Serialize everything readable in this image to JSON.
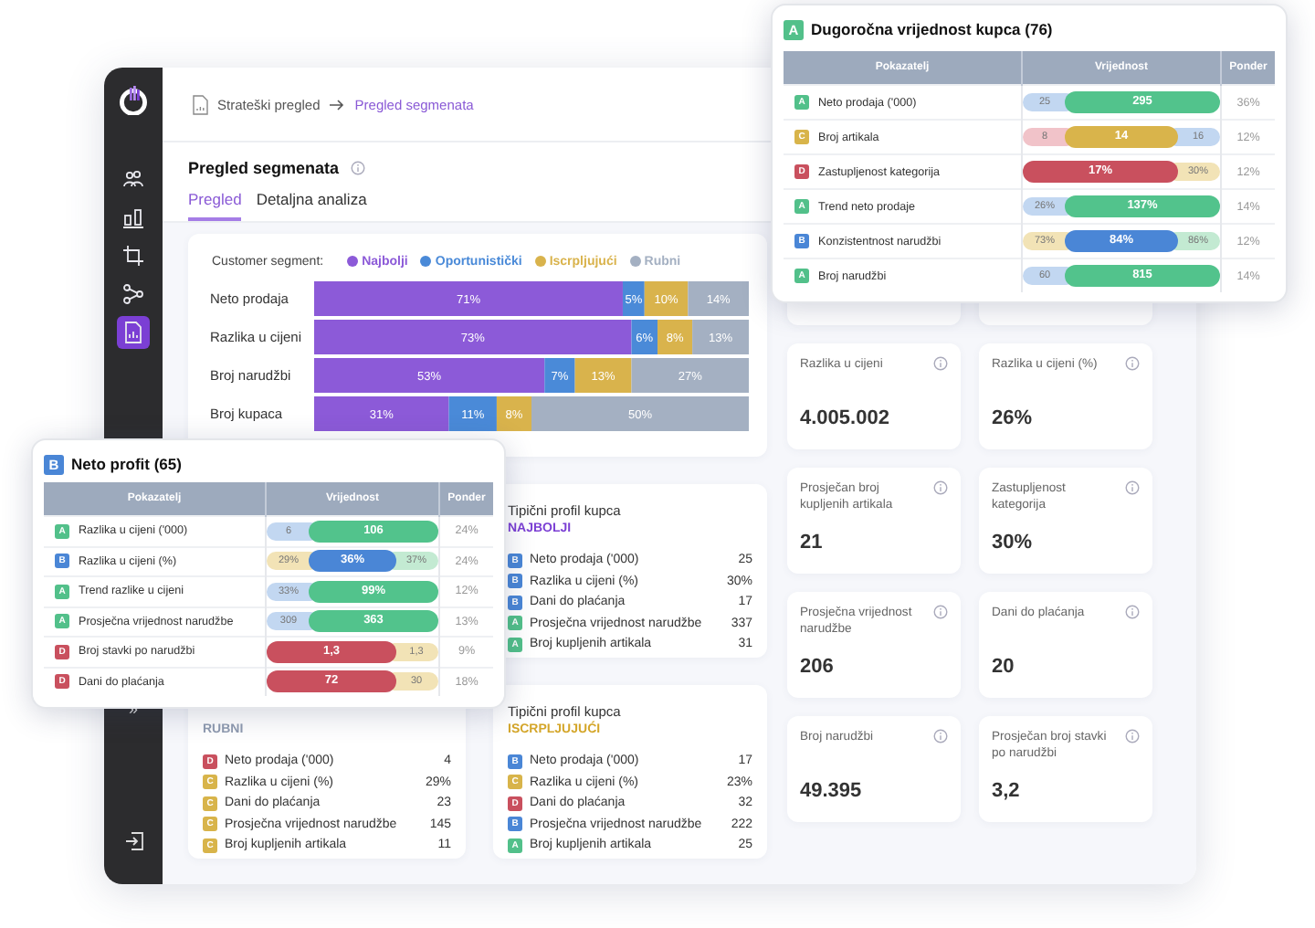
{
  "sidebar": {
    "items": [
      {
        "kind": "people",
        "selected": false
      },
      {
        "kind": "bars",
        "selected": false
      },
      {
        "kind": "crop",
        "selected": false
      },
      {
        "kind": "network",
        "selected": false
      },
      {
        "kind": "report",
        "selected": true
      }
    ],
    "collapse": "»"
  },
  "breadcrumb": [
    "Strateški pregled",
    "Pregled segmenata"
  ],
  "page": {
    "title": "Pregled segmenata",
    "tabs": [
      {
        "label": "Pregled",
        "selected": true
      },
      {
        "label": "Detaljna analiza",
        "selected": false
      }
    ]
  },
  "segment_chart": {
    "legend_label": "Customer segment:",
    "chart_data": {
      "type": "bar",
      "orientation": "horizontal",
      "stacked": true,
      "categories": [
        "Neto prodaja",
        "Razlika u cijeni",
        "Broj narudžbi",
        "Broj kupaca"
      ],
      "series": [
        {
          "name": "Najbolji",
          "color": "#8c5ad8",
          "values": [
            71,
            73,
            53,
            31
          ],
          "value_labels": [
            "71%",
            "73%",
            "53%",
            "31%"
          ]
        },
        {
          "name": "Oportunistički",
          "color": "#4a8ad8",
          "values": [
            5,
            6,
            7,
            11
          ],
          "value_labels": [
            "5%",
            "6%",
            "7%",
            "11%"
          ]
        },
        {
          "name": "Iscrpljujući",
          "color": "#d9b34c",
          "values": [
            10,
            8,
            13,
            8
          ],
          "value_labels": [
            "10%",
            "8%",
            "13%",
            "8%"
          ]
        },
        {
          "name": "Rubni",
          "color": "#a4b0c2",
          "values": [
            14,
            13,
            27,
            50
          ],
          "value_labels": [
            "14%",
            "13%",
            "27%",
            "50%"
          ]
        }
      ]
    }
  },
  "profiles": [
    {
      "title": "Tipični profil kupca",
      "segment": "NAJBOLJI",
      "color": "#7b3fd4",
      "rows": [
        {
          "grade": "B",
          "color": "#4a86d6",
          "name": "Neto prodaja ('000)",
          "value": "25"
        },
        {
          "grade": "B",
          "color": "#4a86d6",
          "name": "Razlika u cijeni (%)",
          "value": "30%"
        },
        {
          "grade": "B",
          "color": "#4a86d6",
          "name": "Dani do plaćanja",
          "value": "17"
        },
        {
          "grade": "A",
          "color": "#52c08a",
          "name": "Prosječna vrijednost narudžbe",
          "value": "337"
        },
        {
          "grade": "A",
          "color": "#52c08a",
          "name": "Broj kupljenih artikala",
          "value": "31"
        }
      ]
    },
    {
      "segment": "RUBNI",
      "color": "#8f9bb0",
      "rows": [
        {
          "grade": "D",
          "color": "#c9505e",
          "name": "Neto prodaja ('000)",
          "value": "4"
        },
        {
          "grade": "C",
          "color": "#d8b44a",
          "name": "Razlika u cijeni (%)",
          "value": "29%"
        },
        {
          "grade": "C",
          "color": "#d8b44a",
          "name": "Dani do plaćanja",
          "value": "23"
        },
        {
          "grade": "C",
          "color": "#d8b44a",
          "name": "Prosječna vrijednost narudžbe",
          "value": "145"
        },
        {
          "grade": "C",
          "color": "#d8b44a",
          "name": "Broj kupljenih artikala",
          "value": "11"
        }
      ]
    },
    {
      "title": "Tipični profil kupca",
      "segment": "ISCRPLJUJUĆI",
      "color": "#d4a62a",
      "rows": [
        {
          "grade": "B",
          "color": "#4a86d6",
          "name": "Neto prodaja ('000)",
          "value": "17"
        },
        {
          "grade": "C",
          "color": "#d8b44a",
          "name": "Razlika u cijeni (%)",
          "value": "23%"
        },
        {
          "grade": "D",
          "color": "#c9505e",
          "name": "Dani do plaćanja",
          "value": "32"
        },
        {
          "grade": "B",
          "color": "#4a86d6",
          "name": "Prosječna vrijednost narudžbe",
          "value": "222"
        },
        {
          "grade": "A",
          "color": "#52c08a",
          "name": "Broj kupljenih artikala",
          "value": "25"
        }
      ]
    }
  ],
  "metrics": [
    {
      "label": "Razlika u cijeni",
      "value": "4.005.002"
    },
    {
      "label": "Razlika u cijeni (%)",
      "value": "26%"
    },
    {
      "label": "Prosječan broj kupljenih artikala",
      "value": "21"
    },
    {
      "label": "Zastupljenost kategorija",
      "value": "30%"
    },
    {
      "label": "Prosječna vrijednost narudžbe",
      "value": "206"
    },
    {
      "label": "Dani do plaćanja",
      "value": "20"
    },
    {
      "label": "Broj narudžbi",
      "value": "49.395"
    },
    {
      "label": "Prosječan broj stavki po narudžbi",
      "value": "3,2"
    }
  ],
  "score_cards": [
    {
      "grade": "A",
      "color": "#52c08a",
      "title": "Dugoročna vrijednost kupca (76)",
      "columns": [
        "Pokazatelj",
        "Vrijednost",
        "Ponder"
      ],
      "rows": [
        {
          "grade": "A",
          "color": "#52c08a",
          "name": "Neto prodaja ('000)",
          "pills": [
            {
              "text": "25",
              "kind": "ref",
              "color": "#c2d7f1"
            },
            {
              "text": "295",
              "kind": "main",
              "color": "#52c38c"
            }
          ],
          "weight": "36%"
        },
        {
          "grade": "C",
          "color": "#d8b44a",
          "name": "Broj artikala",
          "pills": [
            {
              "text": "8",
              "kind": "ref",
              "color": "#f1c3c9"
            },
            {
              "text": "14",
              "kind": "main",
              "color": "#d9b44b"
            },
            {
              "text": "16",
              "kind": "ref",
              "color": "#c2d7f1"
            }
          ],
          "weight": "12%"
        },
        {
          "grade": "D",
          "color": "#c9505e",
          "name": "Zastupljenost kategorija",
          "pills": [
            {
              "text": "17%",
              "kind": "main",
              "color": "#c9505e"
            },
            {
              "text": "30%",
              "kind": "ref",
              "color": "#f2e3b6"
            }
          ],
          "weight": "12%"
        },
        {
          "grade": "A",
          "color": "#52c08a",
          "name": "Trend neto prodaje",
          "pills": [
            {
              "text": "26%",
              "kind": "ref",
              "color": "#c2d7f1"
            },
            {
              "text": "137%",
              "kind": "main",
              "color": "#52c38c"
            }
          ],
          "weight": "14%"
        },
        {
          "grade": "B",
          "color": "#4a86d6",
          "name": "Konzistentnost narudžbi",
          "pills": [
            {
              "text": "73%",
              "kind": "ref",
              "color": "#f2e3b6"
            },
            {
              "text": "84%",
              "kind": "main",
              "color": "#4a86d6"
            },
            {
              "text": "86%",
              "kind": "ref",
              "color": "#c3ead2"
            }
          ],
          "weight": "12%"
        },
        {
          "grade": "A",
          "color": "#52c08a",
          "name": "Broj narudžbi",
          "pills": [
            {
              "text": "60",
              "kind": "ref",
              "color": "#c2d7f1"
            },
            {
              "text": "815",
              "kind": "main",
              "color": "#52c38c"
            }
          ],
          "weight": "14%"
        }
      ]
    },
    {
      "grade": "B",
      "color": "#4a86d6",
      "title": "Neto profit (65)",
      "columns": [
        "Pokazatelj",
        "Vrijednost",
        "Ponder"
      ],
      "rows": [
        {
          "grade": "A",
          "color": "#52c08a",
          "name": "Razlika u cijeni ('000)",
          "pills": [
            {
              "text": "6",
              "kind": "ref",
              "color": "#c2d7f1"
            },
            {
              "text": "106",
              "kind": "main",
              "color": "#52c38c"
            }
          ],
          "weight": "24%"
        },
        {
          "grade": "B",
          "color": "#4a86d6",
          "name": "Razlika u cijeni (%)",
          "pills": [
            {
              "text": "29%",
              "kind": "ref",
              "color": "#f2e3b6"
            },
            {
              "text": "36%",
              "kind": "main",
              "color": "#4a86d6"
            },
            {
              "text": "37%",
              "kind": "ref",
              "color": "#c3ead2"
            }
          ],
          "weight": "24%"
        },
        {
          "grade": "A",
          "color": "#52c08a",
          "name": "Trend razlike u cijeni",
          "pills": [
            {
              "text": "33%",
              "kind": "ref",
              "color": "#c2d7f1"
            },
            {
              "text": "99%",
              "kind": "main",
              "color": "#52c38c"
            }
          ],
          "weight": "12%"
        },
        {
          "grade": "A",
          "color": "#52c08a",
          "name": "Prosječna vrijednost narudžbe",
          "pills": [
            {
              "text": "309",
              "kind": "ref",
              "color": "#c2d7f1"
            },
            {
              "text": "363",
              "kind": "main",
              "color": "#52c38c"
            }
          ],
          "weight": "13%"
        },
        {
          "grade": "D",
          "color": "#c9505e",
          "name": "Broj stavki po narudžbi",
          "pills": [
            {
              "text": "1,3",
              "kind": "main",
              "color": "#c9505e"
            },
            {
              "text": "1,3",
              "kind": "ref",
              "color": "#f2e3b6"
            }
          ],
          "weight": "9%"
        },
        {
          "grade": "D",
          "color": "#c9505e",
          "name": "Dani do plaćanja",
          "pills": [
            {
              "text": "72",
              "kind": "main",
              "color": "#c9505e"
            },
            {
              "text": "30",
              "kind": "ref",
              "color": "#f2e3b6"
            }
          ],
          "weight": "18%"
        }
      ]
    }
  ]
}
